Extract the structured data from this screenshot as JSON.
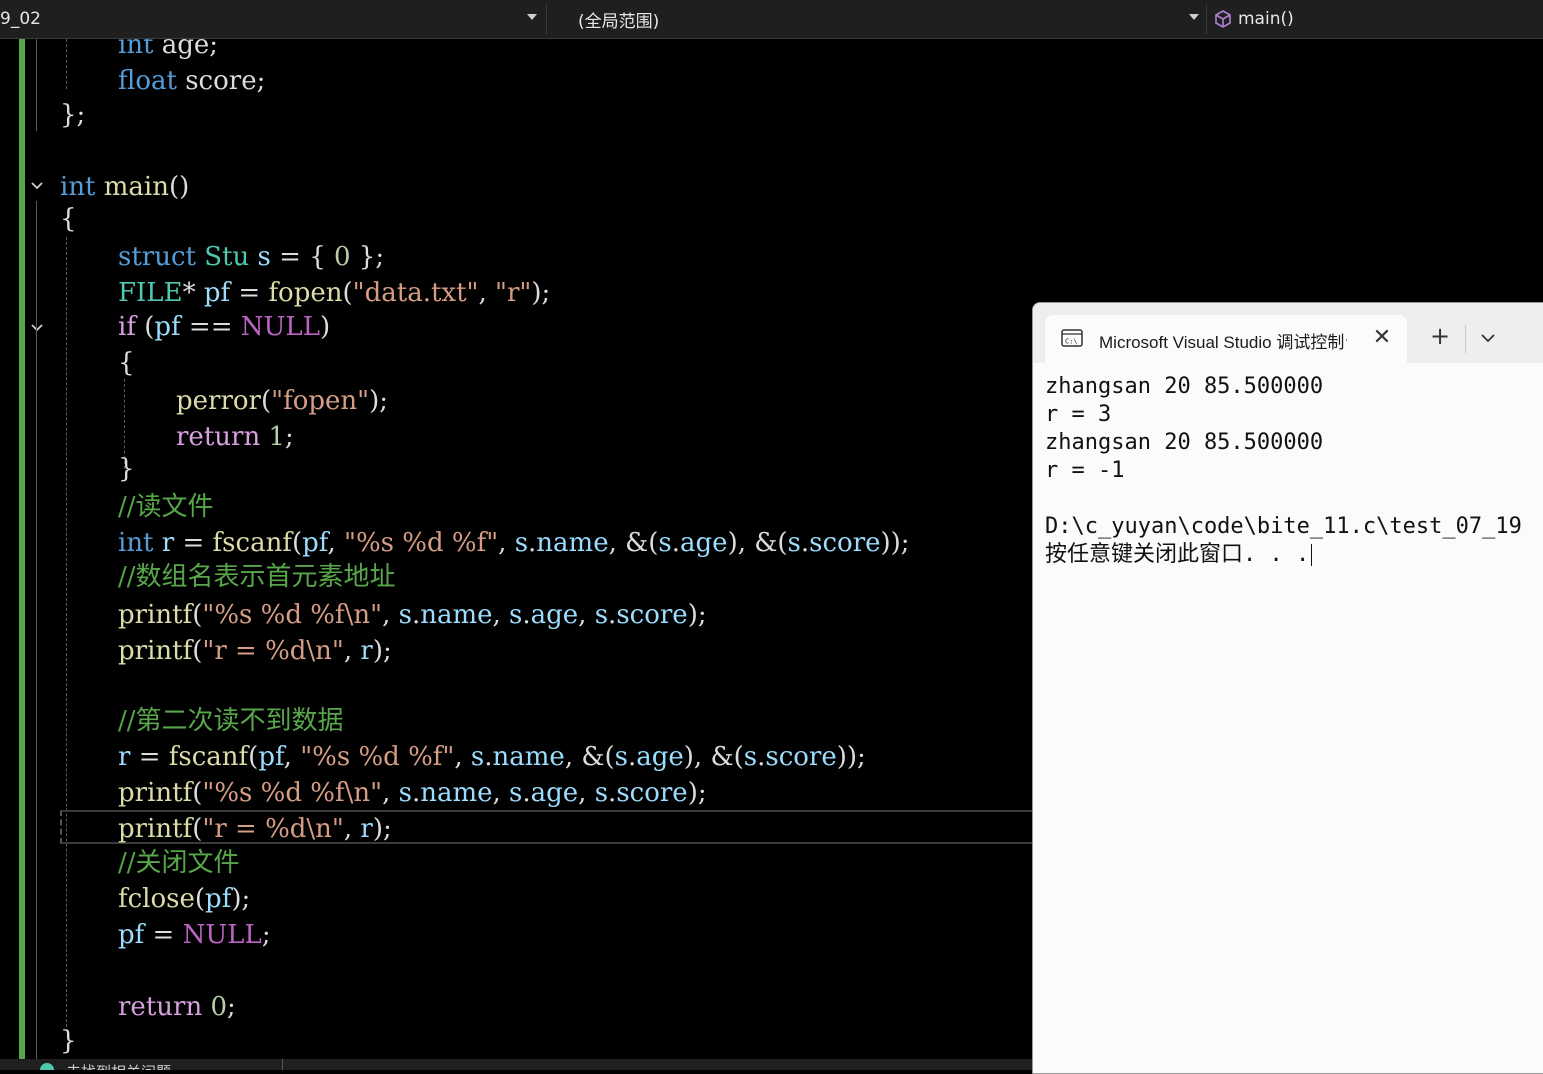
{
  "navbar": {
    "project_fragment": "9_02",
    "scope": "(全局范围)",
    "function": "main()"
  },
  "editor": {
    "lines": [
      [
        [
          "kw",
          "int"
        ],
        [
          "t",
          " age;"
        ]
      ],
      [
        [
          "kw",
          "float"
        ],
        [
          "t",
          " score;"
        ]
      ],
      [
        [
          "t",
          "};"
        ]
      ],
      [
        [
          "t",
          ""
        ]
      ],
      [
        [
          "kw",
          "int"
        ],
        [
          "t",
          " "
        ],
        [
          "fn",
          "main"
        ],
        [
          "t",
          "()"
        ]
      ],
      [
        [
          "t",
          "{"
        ]
      ],
      [
        [
          "kw",
          "struct"
        ],
        [
          "t",
          " "
        ],
        [
          "ty",
          "Stu"
        ],
        [
          "t",
          " "
        ],
        [
          "var",
          "s"
        ],
        [
          "t",
          " = { "
        ],
        [
          "num",
          "0"
        ],
        [
          "t",
          " };"
        ]
      ],
      [
        [
          "ty",
          "FILE"
        ],
        [
          "t",
          "* "
        ],
        [
          "var",
          "pf"
        ],
        [
          "t",
          " = "
        ],
        [
          "fn",
          "fopen"
        ],
        [
          "t",
          "("
        ],
        [
          "str",
          "\"data.txt\""
        ],
        [
          "t",
          ", "
        ],
        [
          "str",
          "\"r\""
        ],
        [
          "t",
          ");"
        ]
      ],
      [
        [
          "ctl",
          "if"
        ],
        [
          "t",
          " ("
        ],
        [
          "var",
          "pf"
        ],
        [
          "t",
          " == "
        ],
        [
          "mac",
          "NULL"
        ],
        [
          "t",
          ")"
        ]
      ],
      [
        [
          "t",
          "{"
        ]
      ],
      [
        [
          "fn",
          "perror"
        ],
        [
          "t",
          "("
        ],
        [
          "str",
          "\"fopen\""
        ],
        [
          "t",
          ");"
        ]
      ],
      [
        [
          "ctl",
          "return"
        ],
        [
          "t",
          " "
        ],
        [
          "num",
          "1"
        ],
        [
          "t",
          ";"
        ]
      ],
      [
        [
          "t",
          "}"
        ]
      ],
      [
        [
          "cm",
          "//读文件"
        ]
      ],
      [
        [
          "kw",
          "int"
        ],
        [
          "t",
          " "
        ],
        [
          "var",
          "r"
        ],
        [
          "t",
          " = "
        ],
        [
          "fn",
          "fscanf"
        ],
        [
          "t",
          "("
        ],
        [
          "var",
          "pf"
        ],
        [
          "t",
          ", "
        ],
        [
          "str",
          "\"%s %d %f\""
        ],
        [
          "t",
          ", "
        ],
        [
          "var",
          "s"
        ],
        [
          "t",
          "."
        ],
        [
          "var",
          "name"
        ],
        [
          "t",
          ", &("
        ],
        [
          "var",
          "s"
        ],
        [
          "t",
          "."
        ],
        [
          "var",
          "age"
        ],
        [
          "t",
          "), &("
        ],
        [
          "var",
          "s"
        ],
        [
          "t",
          "."
        ],
        [
          "var",
          "score"
        ],
        [
          "t",
          "));"
        ]
      ],
      [
        [
          "cm",
          "//数组名表示首元素地址"
        ]
      ],
      [
        [
          "fn",
          "printf"
        ],
        [
          "t",
          "("
        ],
        [
          "str",
          "\"%s %d %f\\n\""
        ],
        [
          "t",
          ", "
        ],
        [
          "var",
          "s"
        ],
        [
          "t",
          "."
        ],
        [
          "var",
          "name"
        ],
        [
          "t",
          ", "
        ],
        [
          "var",
          "s"
        ],
        [
          "t",
          "."
        ],
        [
          "var",
          "age"
        ],
        [
          "t",
          ", "
        ],
        [
          "var",
          "s"
        ],
        [
          "t",
          "."
        ],
        [
          "var",
          "score"
        ],
        [
          "t",
          ");"
        ]
      ],
      [
        [
          "fn",
          "printf"
        ],
        [
          "t",
          "("
        ],
        [
          "str",
          "\"r = %d\\n\""
        ],
        [
          "t",
          ", "
        ],
        [
          "var",
          "r"
        ],
        [
          "t",
          ");"
        ]
      ],
      [
        [
          "t",
          ""
        ]
      ],
      [
        [
          "cm",
          "//第二次读不到数据"
        ]
      ],
      [
        [
          "var",
          "r"
        ],
        [
          "t",
          " = "
        ],
        [
          "fn",
          "fscanf"
        ],
        [
          "t",
          "("
        ],
        [
          "var",
          "pf"
        ],
        [
          "t",
          ", "
        ],
        [
          "str",
          "\"%s %d %f\""
        ],
        [
          "t",
          ", "
        ],
        [
          "var",
          "s"
        ],
        [
          "t",
          "."
        ],
        [
          "var",
          "name"
        ],
        [
          "t",
          ", &("
        ],
        [
          "var",
          "s"
        ],
        [
          "t",
          "."
        ],
        [
          "var",
          "age"
        ],
        [
          "t",
          "), &("
        ],
        [
          "var",
          "s"
        ],
        [
          "t",
          "."
        ],
        [
          "var",
          "score"
        ],
        [
          "t",
          "));"
        ]
      ],
      [
        [
          "fn",
          "printf"
        ],
        [
          "t",
          "("
        ],
        [
          "str",
          "\"%s %d %f\\n\""
        ],
        [
          "t",
          ", "
        ],
        [
          "var",
          "s"
        ],
        [
          "t",
          "."
        ],
        [
          "var",
          "name"
        ],
        [
          "t",
          ", "
        ],
        [
          "var",
          "s"
        ],
        [
          "t",
          "."
        ],
        [
          "var",
          "age"
        ],
        [
          "t",
          ", "
        ],
        [
          "var",
          "s"
        ],
        [
          "t",
          "."
        ],
        [
          "var",
          "score"
        ],
        [
          "t",
          ");"
        ]
      ],
      [
        [
          "fn",
          "printf"
        ],
        [
          "t",
          "("
        ],
        [
          "str",
          "\"r = %d\\n\""
        ],
        [
          "t",
          ", "
        ],
        [
          "var",
          "r"
        ],
        [
          "t",
          ");"
        ]
      ],
      [
        [
          "cm",
          "//关闭文件"
        ]
      ],
      [
        [
          "fn",
          "fclose"
        ],
        [
          "t",
          "("
        ],
        [
          "var",
          "pf"
        ],
        [
          "t",
          ");"
        ]
      ],
      [
        [
          "var",
          "pf"
        ],
        [
          "t",
          " = "
        ],
        [
          "mac",
          "NULL"
        ],
        [
          "t",
          ";"
        ]
      ],
      [
        [
          "t",
          ""
        ]
      ],
      [
        [
          "ctl",
          "return"
        ],
        [
          "t",
          " "
        ],
        [
          "num",
          "0"
        ],
        [
          "t",
          ";"
        ]
      ],
      [
        [
          "t",
          "}"
        ]
      ]
    ]
  },
  "console": {
    "title": "Microsoft Visual Studio 调试控制台",
    "lines": [
      "zhangsan 20 85.500000",
      "r = 3",
      "zhangsan 20 85.500000",
      "r = -1",
      "",
      "D:\\c_yuyan\\code\\bite_11.c\\test_07_19",
      "按任意键关闭此窗口. . ."
    ]
  },
  "statusbar": {
    "text": "未找到相关问题"
  },
  "colors": {
    "keyword": "#569cd6",
    "type": "#4ec9b0",
    "function": "#dcdcaa",
    "string": "#d69d85",
    "number": "#b5cea8",
    "comment": "#57a64a",
    "variable": "#9cdcfe",
    "control": "#d8a0df",
    "macro": "#bd63c5"
  }
}
